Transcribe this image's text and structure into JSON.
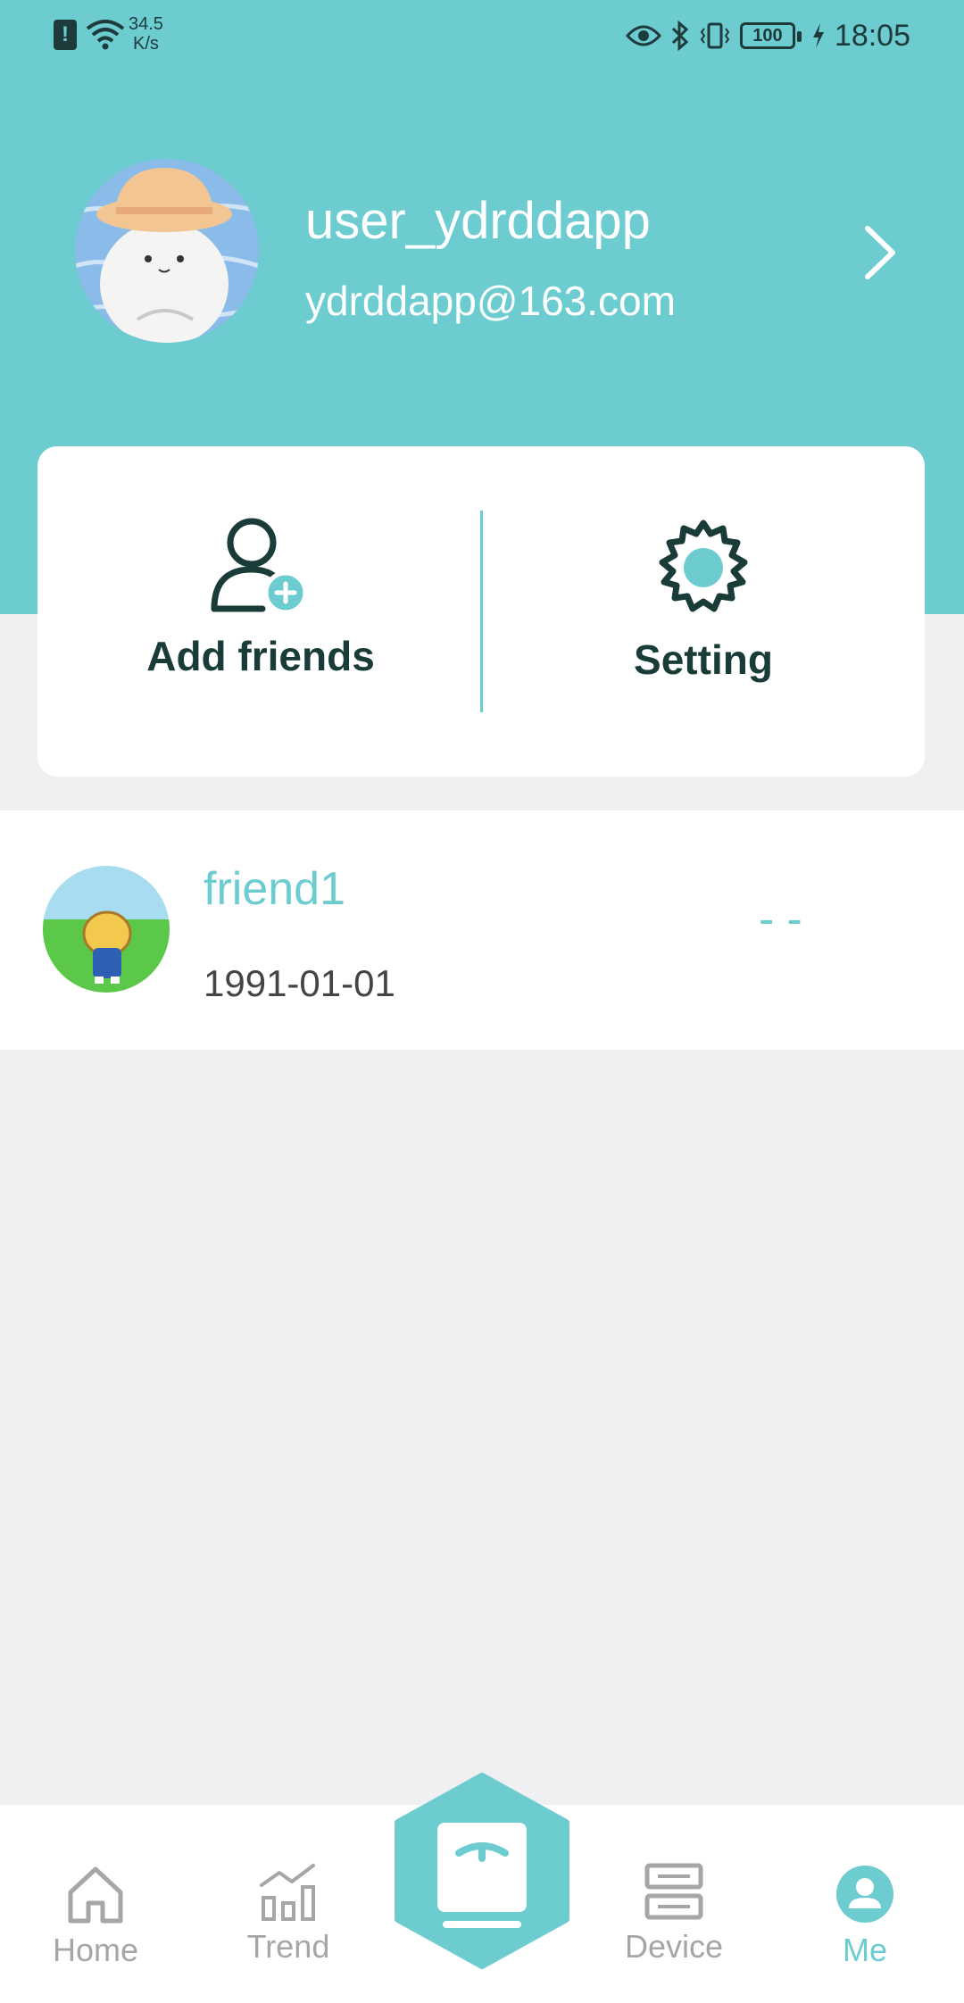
{
  "status_bar": {
    "alert": "!",
    "net_speed_value": "34.5",
    "net_speed_unit": "K/s",
    "battery": "100",
    "time": "18:05"
  },
  "profile": {
    "username": "user_ydrddapp",
    "email": "ydrddapp@163.com"
  },
  "actions": {
    "add_friends": "Add friends",
    "setting": "Setting"
  },
  "friends": [
    {
      "name": "friend1",
      "date": "1991-01-01",
      "value": "--"
    }
  ],
  "nav": {
    "home": "Home",
    "trend": "Trend",
    "device": "Device",
    "me": "Me",
    "active": "me"
  },
  "colors": {
    "accent": "#6cccd0",
    "dark": "#1a3c38",
    "background": "#f0f0f2"
  }
}
